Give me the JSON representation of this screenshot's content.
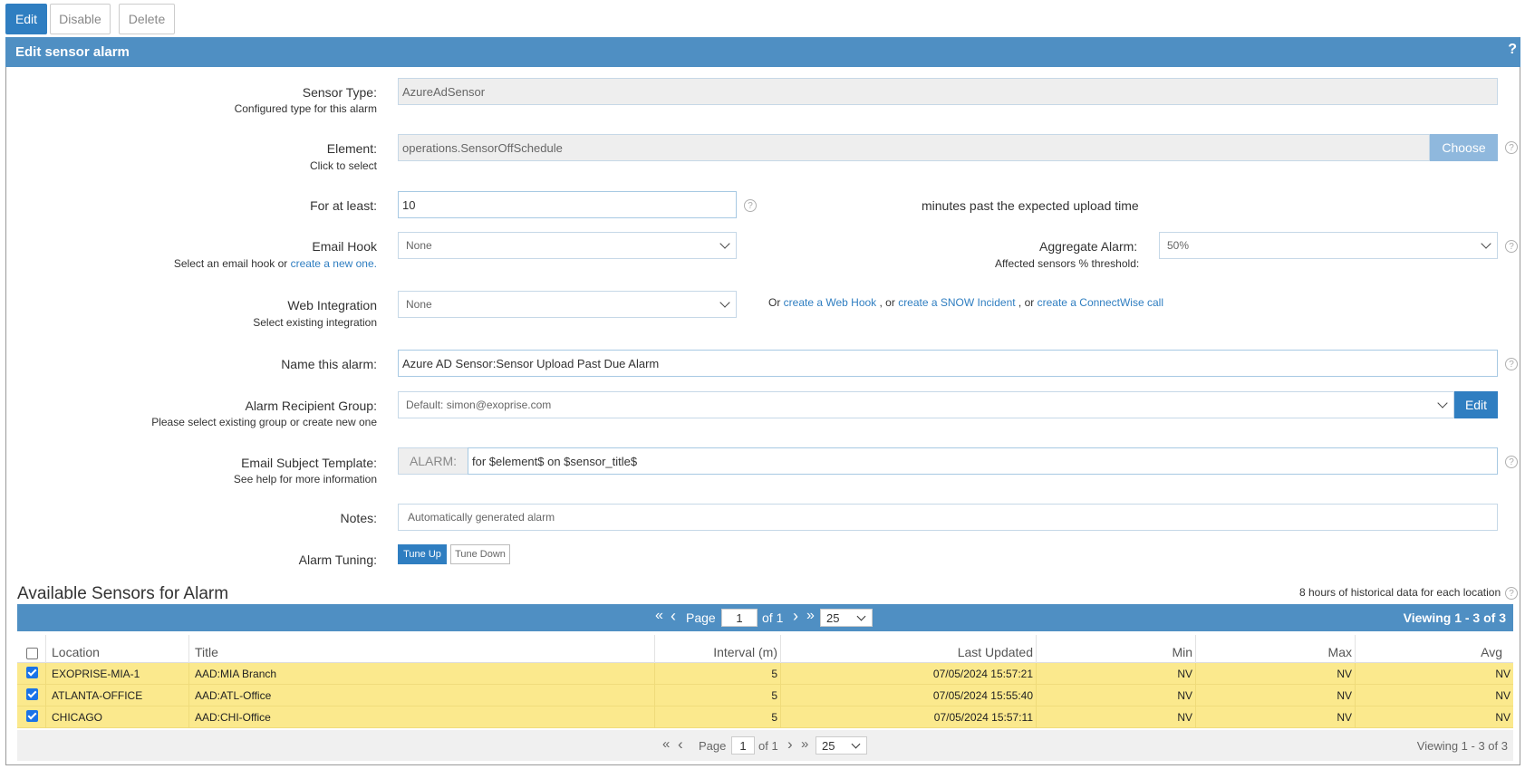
{
  "toolbar": {
    "edit_label": "Edit",
    "disable_label": "Disable",
    "delete_label": "Delete"
  },
  "panel": {
    "title": "Edit sensor alarm",
    "help": "?"
  },
  "form": {
    "sensor_type": {
      "label": "Sensor Type:",
      "sub": "Configured type for this alarm",
      "value": "AzureAdSensor"
    },
    "element": {
      "label": "Element:",
      "sub": "Click to select",
      "value": "operations.SensorOffSchedule",
      "button": "Choose"
    },
    "for_at_least": {
      "label": "For at least:",
      "value": "10",
      "suffix": "minutes past the expected upload time"
    },
    "email_hook": {
      "label": "Email Hook",
      "sub_prefix": "Select an email hook or ",
      "sub_link": "create a new one.",
      "value": "None"
    },
    "aggregate": {
      "label": "Aggregate Alarm:",
      "sub": "Affected sensors % threshold:",
      "value": "50%"
    },
    "web_integration": {
      "label": "Web Integration",
      "sub": "Select existing integration",
      "value": "None",
      "or1": "Or ",
      "link1": "create a Web Hook",
      "or2": " , or ",
      "link2": "create a SNOW Incident",
      "or3": " , or ",
      "link3": "create a ConnectWise call"
    },
    "name": {
      "label": "Name this alarm:",
      "value": "Azure AD Sensor:Sensor Upload Past Due Alarm"
    },
    "recipient": {
      "label": "Alarm Recipient Group:",
      "sub": "Please select existing group or create new one",
      "value": "Default: simon@exoprise.com",
      "button": "Edit"
    },
    "subject": {
      "label": "Email Subject Template:",
      "sub": "See help for more information",
      "prefix": "ALARM:",
      "value": "for $element$ on $sensor_title$"
    },
    "notes": {
      "label": "Notes:",
      "placeholder": "Automatically generated alarm"
    },
    "tuning": {
      "label": "Alarm Tuning:",
      "up": "Tune Up",
      "down": "Tune Down"
    }
  },
  "sensors": {
    "title": "Available Sensors for Alarm",
    "history_note": "8 hours of historical data for each location",
    "pager": {
      "page_label": "Page",
      "page_value": "1",
      "of_label": "of 1",
      "page_size": "25",
      "viewing": "Viewing 1 - 3 of 3"
    },
    "columns": [
      "Location",
      "Title",
      "Interval (m)",
      "Last Updated",
      "Min",
      "Max",
      "Avg"
    ],
    "rows": [
      {
        "location": "EXOPRISE-MIA-1",
        "title": "AAD:MIA Branch",
        "interval": "5",
        "updated": "07/05/2024 15:57:21",
        "min": "NV",
        "max": "NV",
        "avg": "NV"
      },
      {
        "location": "ATLANTA-OFFICE",
        "title": "AAD:ATL-Office",
        "interval": "5",
        "updated": "07/05/2024 15:55:40",
        "min": "NV",
        "max": "NV",
        "avg": "NV"
      },
      {
        "location": "CHICAGO",
        "title": "AAD:CHI-Office",
        "interval": "5",
        "updated": "07/05/2024 15:57:11",
        "min": "NV",
        "max": "NV",
        "avg": "NV"
      }
    ]
  },
  "icons": {
    "first": "«",
    "prev": "‹",
    "next": "›",
    "last": "»",
    "help": "?"
  }
}
